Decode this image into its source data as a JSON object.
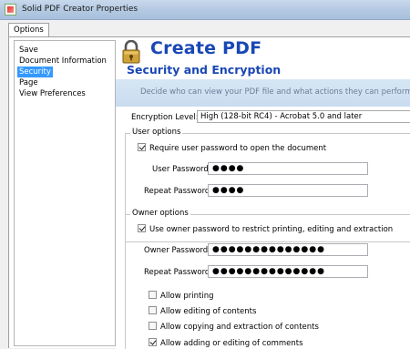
{
  "window": {
    "title": "Solid PDF Creator Properties"
  },
  "tabs": [
    {
      "label": "Options"
    }
  ],
  "tree": {
    "items": [
      {
        "label": "Save",
        "selected": false
      },
      {
        "label": "Document Information",
        "selected": false
      },
      {
        "label": "Security",
        "selected": true
      },
      {
        "label": "Page",
        "selected": false
      },
      {
        "label": "View Preferences",
        "selected": false
      }
    ]
  },
  "header": {
    "title": "Create PDF",
    "subtitle": "Security and Encryption",
    "description": "Decide who can view your PDF file and what actions they can perform with the file.",
    "icon": "lock-icon"
  },
  "encryption": {
    "label": "Encryption Level:",
    "value": "High (128-bit RC4) - Acrobat 5.0 and later"
  },
  "user_options": {
    "title": "User options",
    "require_label": "Require user password to open the document",
    "require_checked": true,
    "user_password_label": "User Password:",
    "user_password_value": "●●●●",
    "repeat_password_label": "Repeat Password:",
    "repeat_password_value": "●●●●"
  },
  "owner_options": {
    "title": "Owner options",
    "use_label": "Use owner password to restrict printing, editing and extraction",
    "use_checked": true,
    "owner_password_label": "Owner Password:",
    "owner_password_value": "●●●●●●●●●●●●●●",
    "repeat_password_label": "Repeat Password:",
    "repeat_password_value": "●●●●●●●●●●●●●●",
    "permissions": [
      {
        "label": "Allow printing",
        "checked": false
      },
      {
        "label": "Allow editing of contents",
        "checked": false
      },
      {
        "label": "Allow copying and extraction of contents",
        "checked": false
      },
      {
        "label": "Allow adding or editing of comments",
        "checked": true
      }
    ]
  }
}
